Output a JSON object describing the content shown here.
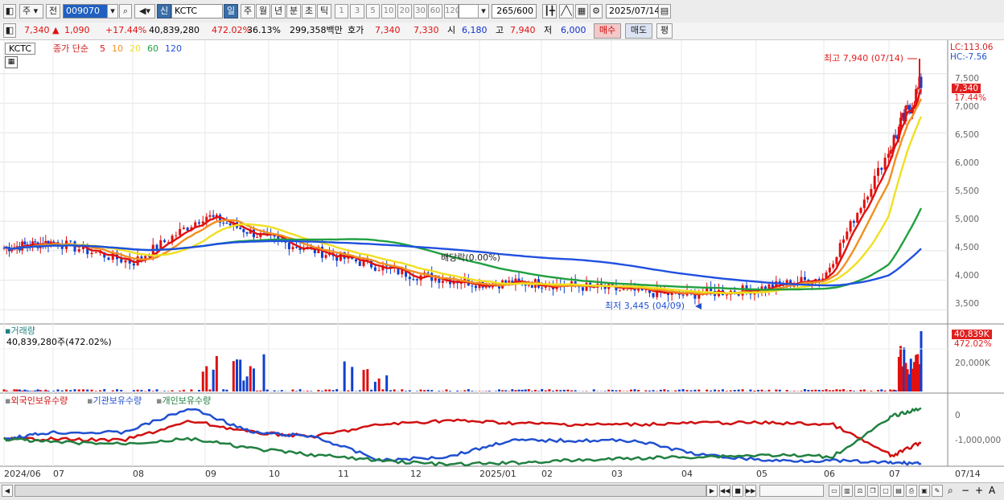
{
  "toolbar": {
    "market_label": "주",
    "prev_label": "전",
    "code": "009070",
    "new_badge": "신",
    "stock_name": "KCTC",
    "periods": [
      "일",
      "주",
      "월",
      "년",
      "분",
      "초",
      "틱"
    ],
    "active_period": "일",
    "nums": [
      "1",
      "3",
      "5",
      "10",
      "20",
      "30",
      "60",
      "120"
    ],
    "count": "265",
    "count_total": "/600",
    "date": "2025/07/14"
  },
  "quote": {
    "price": "7,340",
    "arrow": "▲",
    "change": "1,090",
    "change_pct": "+17.44%",
    "volume": "40,839,280",
    "vol_ratio": "472.02%",
    "turnover": "36.13%",
    "amount": "299,358백만",
    "bid_label": "호가",
    "bid1": "7,340",
    "bid2": "7,330",
    "open_label": "시",
    "open": "6,180",
    "high_label": "고",
    "high": "7,940",
    "low_label": "저",
    "low": "6,000",
    "buy": "매수",
    "sell": "매도",
    "eval": "평"
  },
  "main_panel": {
    "ticker_box": "KCTC",
    "legend_prefix": "종가 단순",
    "ma_labels": [
      {
        "text": "5",
        "color": "#e01010"
      },
      {
        "text": "10",
        "color": "#f09020"
      },
      {
        "text": "20",
        "color": "#f0e020"
      },
      {
        "text": "60",
        "color": "#20a040"
      },
      {
        "text": "120",
        "color": "#2050e0"
      }
    ],
    "lc": "LC:113.06",
    "hc": "HC:-7.56",
    "price_tag": "7,340",
    "pct_tag": "17.44%",
    "high_note": "최고 7,940 (07/14)",
    "low_note": "최저 3,445 (04/09)",
    "dividend_note": "배당락(0.00%)",
    "y_ticks": [
      "7,500",
      "7,000",
      "6,500",
      "6,000",
      "5,500",
      "5,000",
      "4,500",
      "4,000",
      "3,500"
    ]
  },
  "volume_panel": {
    "title": "거래량",
    "value": "40,839,280주(472.02%)",
    "tag": "40,839K",
    "pct": "472.02%",
    "y_tick": "20,000K"
  },
  "holdings_panel": {
    "legend": [
      {
        "text": "외국인보유수량",
        "color": "#d01010"
      },
      {
        "text": "기관보유수량",
        "color": "#2050d0"
      },
      {
        "text": "개인보유수량",
        "color": "#208040"
      }
    ],
    "y_ticks": [
      "0",
      "-1,000,000"
    ]
  },
  "x_axis": [
    "2024/06",
    "07",
    "08",
    "09",
    "10",
    "11",
    "12",
    "2025/01",
    "02",
    "03",
    "04",
    "05",
    "06",
    "07"
  ],
  "x_end": "07/14",
  "chart_data": {
    "type": "line",
    "title": "KCTC",
    "note": "daily candlestick price chart with moving averages (5,10,20,60,120), volume and holdings panels",
    "x": [
      "2024/06",
      "07",
      "08",
      "09",
      "10",
      "11",
      "12",
      "2025/01",
      "02",
      "03",
      "04",
      "05",
      "06",
      "07",
      "07/14"
    ],
    "series": [
      {
        "name": "종가",
        "values": [
          4550,
          4650,
          4300,
          5100,
          4700,
          4400,
          4100,
          3950,
          3950,
          3850,
          3750,
          3850,
          4050,
          6200,
          7340
        ]
      },
      {
        "name": "120",
        "values": [
          4050,
          4150,
          4250,
          4450,
          4550,
          4700,
          4650,
          4550,
          4400,
          4300,
          4100,
          3900,
          3900,
          4000,
          4100
        ]
      },
      {
        "name": "60",
        "values": [
          4300,
          4350,
          4700,
          4800,
          5000,
          4850,
          4250,
          4100,
          4000,
          3900,
          3850,
          3850,
          3950,
          4200,
          4400
        ]
      }
    ],
    "high": {
      "value": 7940,
      "date": "07/14"
    },
    "low": {
      "value": 3445,
      "date": "04/09"
    },
    "ylim": [
      3300,
      8000
    ]
  }
}
